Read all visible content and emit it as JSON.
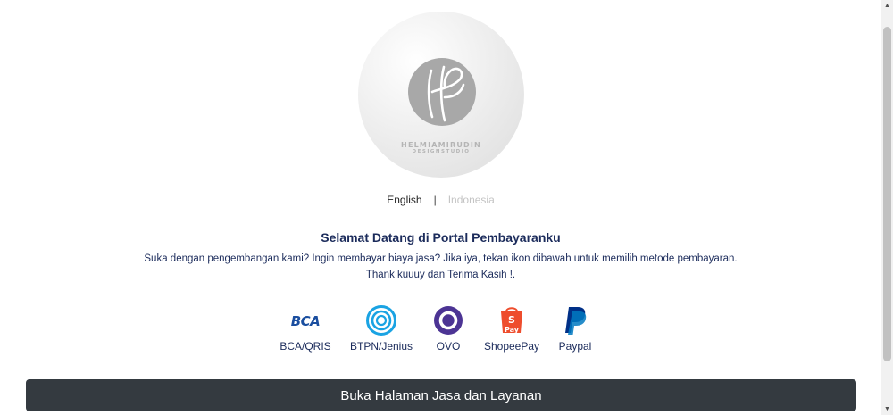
{
  "logo": {
    "brand_line1": "HELMIAMIRUDIN",
    "brand_line2": "DESIGNSTUDIO"
  },
  "language": {
    "english": "English",
    "separator": "|",
    "indonesia": "Indonesia",
    "active": "English"
  },
  "welcome": {
    "title": "Selamat Datang di Portal Pembayaranku",
    "line1": "Suka dengan pengembangan kami? Ingin membayar biaya jasa? Jika iya, tekan ikon dibawah untuk memilih metode pembayaran.",
    "line2": "Thank kuuuy dan Terima Kasih !."
  },
  "payments": [
    {
      "label": "BCA/QRIS",
      "icon": "bca-logo-icon",
      "color": "#1a4e9f"
    },
    {
      "label": "BTPN/Jenius",
      "icon": "jenius-logo-icon",
      "color": "#1aa3e3"
    },
    {
      "label": "OVO",
      "icon": "ovo-logo-icon",
      "color": "#4c3494"
    },
    {
      "label": "ShopeePay",
      "icon": "shopeepay-logo-icon",
      "color": "#ee4d2d"
    },
    {
      "label": "Paypal",
      "icon": "paypal-logo-icon",
      "color": "#003087"
    }
  ],
  "cta": {
    "label": "Buka Halaman Jasa dan Layanan"
  },
  "colors": {
    "text": "#1b2b5b",
    "button": "#343a40"
  }
}
